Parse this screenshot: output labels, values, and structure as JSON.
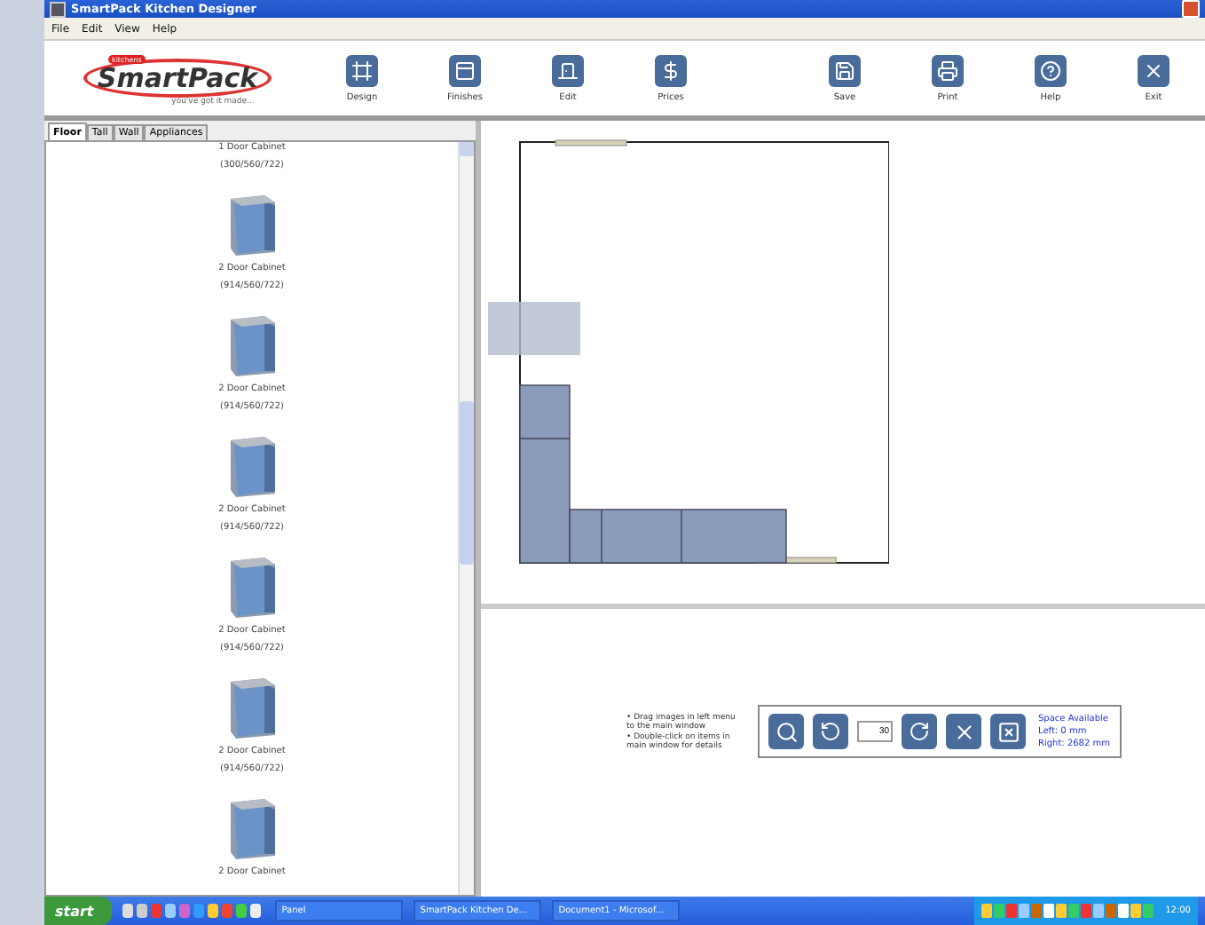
{
  "window": {
    "title": "SmartPack Kitchen Designer"
  },
  "menu": [
    "File",
    "Edit",
    "View",
    "Help"
  ],
  "logo": {
    "badge": "kitchens",
    "name": "SmartPack",
    "tagline": "you've got it made..."
  },
  "toolbar": [
    {
      "label": "Design"
    },
    {
      "label": "Finishes"
    },
    {
      "label": "Edit"
    },
    {
      "label": "Prices"
    },
    {
      "label": "Save"
    },
    {
      "label": "Print"
    },
    {
      "label": "Help"
    },
    {
      "label": "Exit"
    }
  ],
  "tabs": [
    {
      "label": "Floor",
      "selected": true
    },
    {
      "label": "Tall",
      "selected": false
    },
    {
      "label": "Wall",
      "selected": false
    },
    {
      "label": "Appliances",
      "selected": false
    }
  ],
  "cabinets": [
    {
      "name": "1 Door Cabinet",
      "size": "(300/560/722)",
      "image_visible": false
    },
    {
      "name": "2 Door Cabinet",
      "size": "(914/560/722)",
      "image_visible": true
    },
    {
      "name": "2 Door Cabinet",
      "size": "(914/560/722)",
      "image_visible": true
    },
    {
      "name": "2 Door Cabinet",
      "size": "(914/560/722)",
      "image_visible": true
    },
    {
      "name": "2 Door Cabinet",
      "size": "(914/560/722)",
      "image_visible": true
    },
    {
      "name": "2 Door Cabinet",
      "size": "(914/560/722)",
      "image_visible": true
    },
    {
      "name": "2 Door Cabinet",
      "image_visible": true
    }
  ],
  "hints": [
    "• Drag images in left menu to the main window",
    "• Double-click on items in main window for details"
  ],
  "rotation": {
    "value": "30"
  },
  "space": {
    "title": "Space Available",
    "left": "Left: 0 mm",
    "right": "Right: 2682 mm"
  },
  "taskbar": {
    "start": "start",
    "tasks": [
      {
        "label": "Panel"
      },
      {
        "label": "SmartPack Kitchen De..."
      },
      {
        "label": "Document1 - Microsof..."
      }
    ],
    "clock": "12:00"
  }
}
